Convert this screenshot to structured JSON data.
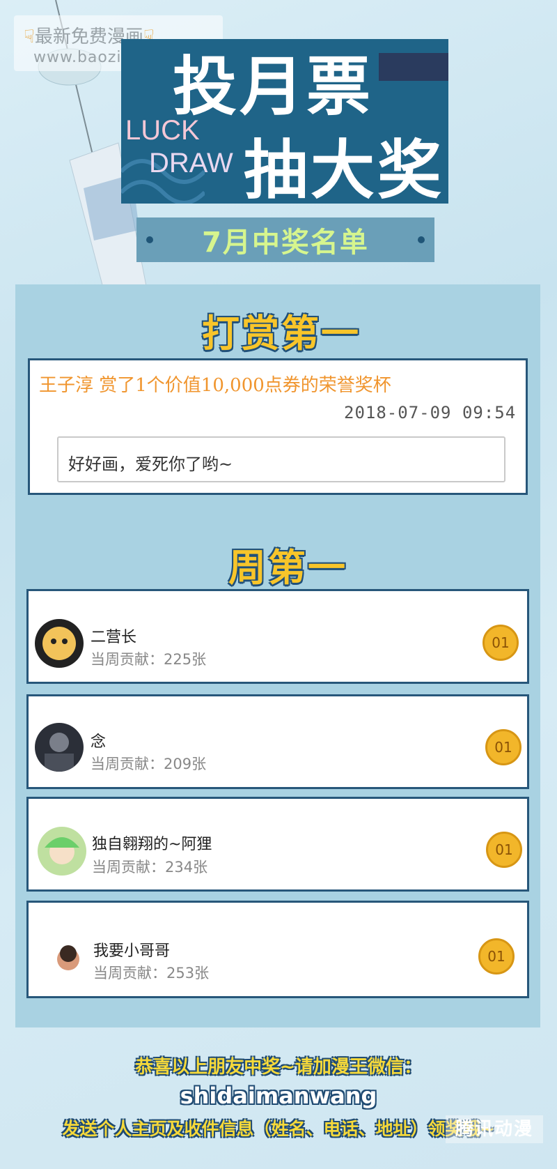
{
  "watermark": {
    "line1": "最新免费漫画",
    "line2": "www.baozimh.com"
  },
  "banner": {
    "title_line1": "投月票",
    "title_line2": "抽大奖",
    "luck": "LUCK",
    "draw": "DRAW"
  },
  "subtitle": "7月中奖名单",
  "reward": {
    "heading": "打赏第一",
    "text": "王子淳 赏了1个价值10,000点券的荣誉奖杯",
    "time": "2018-07-09 09:54",
    "message": "好好画，爱死你了哟~"
  },
  "weekly": {
    "heading": "周第一",
    "items": [
      {
        "name": "二营长",
        "contrib": "当周贡献：225张",
        "medal": "01"
      },
      {
        "name": "念",
        "contrib": "当周贡献：209张",
        "medal": "01"
      },
      {
        "name": "独自翱翔的~阿狸",
        "contrib": "当周贡献：234张",
        "medal": "01"
      },
      {
        "name": "我要小哥哥",
        "contrib": "当周贡献：253张",
        "medal": "01"
      }
    ]
  },
  "footer": {
    "line1": "恭喜以上朋友中奖~请加漫王微信：",
    "line2": "shidaimanwang",
    "line3": "发送个人主页及收件信息（姓名、电话、地址）领奖哦~",
    "logo": "腾讯动漫"
  },
  "colors": {
    "banner": "#1f6488",
    "gold": "#f8c52a",
    "panel": "#a9d2e2",
    "border": "#27577a"
  }
}
